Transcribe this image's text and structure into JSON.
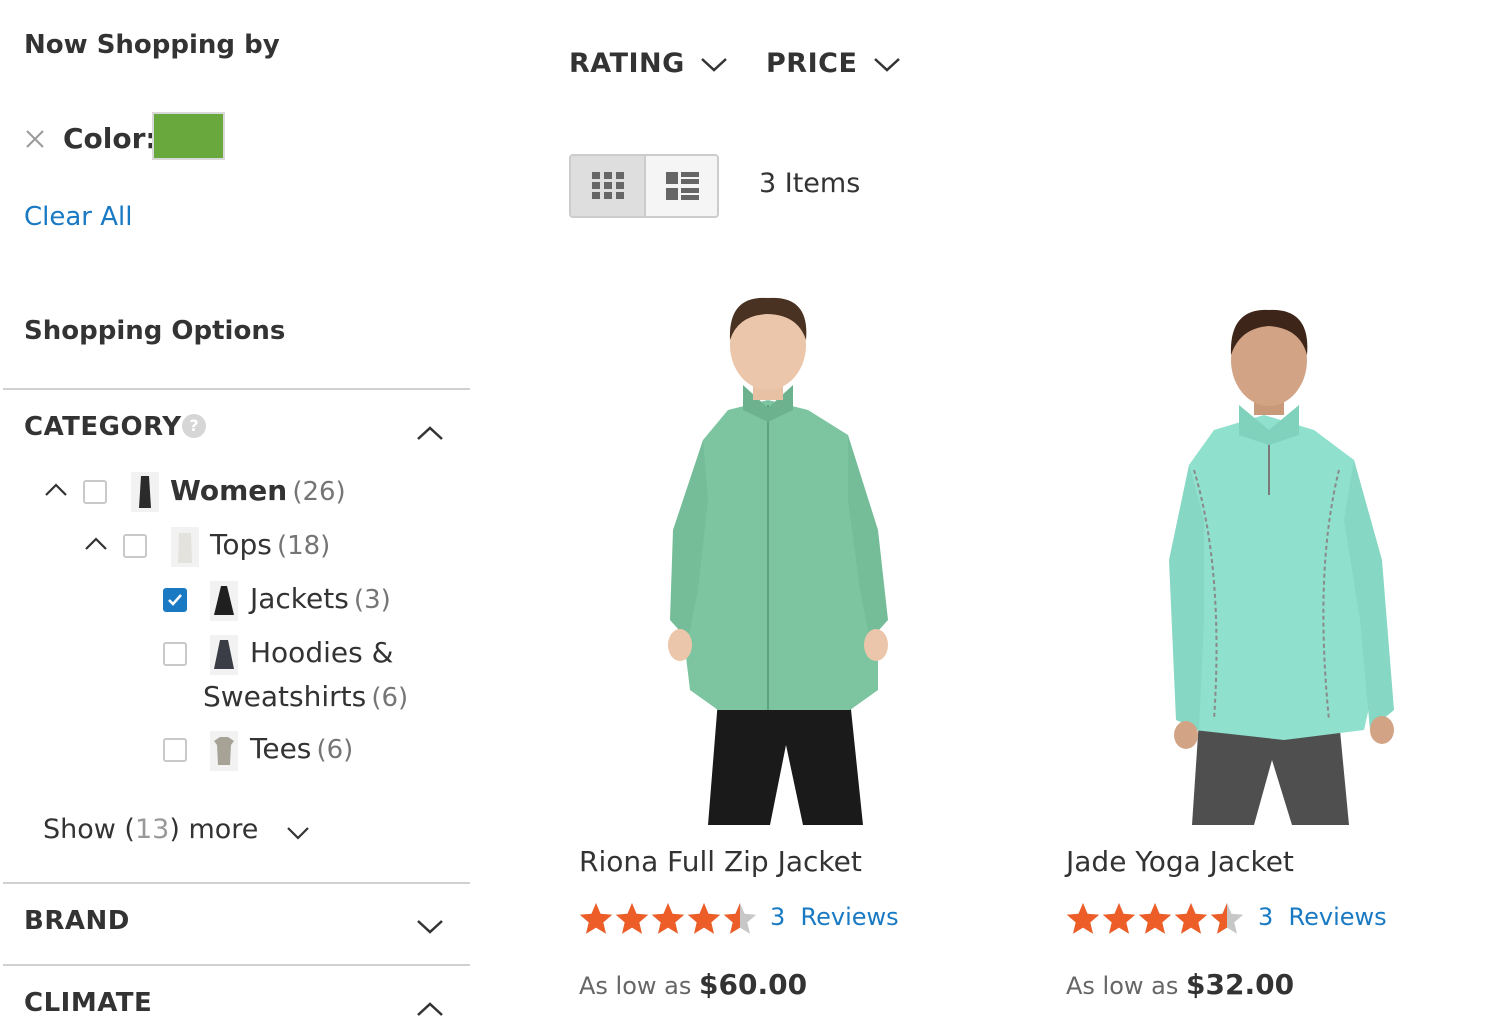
{
  "filters": {
    "now_shopping_title": "Now Shopping by",
    "active": {
      "label": "Color:",
      "swatch_color": "#68a83d",
      "remove_icon": "close-icon"
    },
    "clear_all": "Clear All"
  },
  "shopping_options": {
    "title": "Shopping Options",
    "category": {
      "title": "CATEGORY",
      "help_icon": "?",
      "items": [
        {
          "name": "Women",
          "count": "(26)",
          "checked": false
        },
        {
          "name": "Tops",
          "count": "(18)",
          "checked": false
        },
        {
          "name": "Jackets",
          "count": "(3)",
          "checked": true
        },
        {
          "name": "Hoodies &",
          "name_line2": "Sweatshirts",
          "count": "(6)",
          "checked": false
        },
        {
          "name": "Tees",
          "count": "(6)",
          "checked": false
        }
      ],
      "show_more": {
        "prefix": "Show (",
        "count": "13",
        "suffix": ") more"
      }
    },
    "brand": {
      "title": "BRAND"
    },
    "climate": {
      "title": "CLIMATE"
    }
  },
  "toolbar": {
    "sort_rating": "RATING",
    "sort_price": "PRICE",
    "items_count": "3 Items",
    "view_modes": [
      "grid",
      "list"
    ],
    "active_mode": "grid"
  },
  "products": [
    {
      "name": "Riona Full Zip Jacket",
      "rating": 4.5,
      "review_count": "3",
      "reviews_label": "Reviews",
      "price_prefix": "As low as",
      "price": "$60.00",
      "jacket_color": "#7cc5a0"
    },
    {
      "name": "Jade Yoga Jacket",
      "rating": 4.5,
      "review_count": "3",
      "reviews_label": "Reviews",
      "price_prefix": "As low as",
      "price": "$32.00",
      "jacket_color": "#8fe0cc"
    }
  ],
  "colors": {
    "link": "#1979c3",
    "star": "#ed5d27",
    "star_empty": "#c7c7c7",
    "checkbox_checked": "#1979c3"
  }
}
